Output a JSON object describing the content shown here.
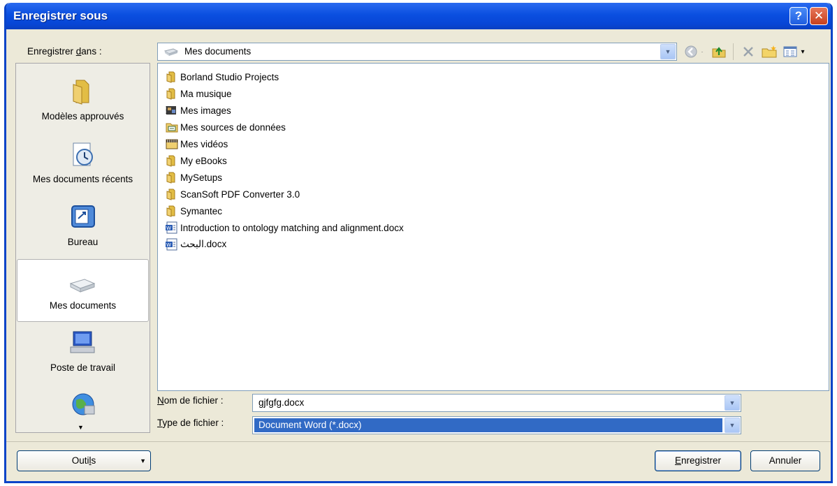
{
  "window": {
    "title": "Enregistrer sous",
    "help_label": "?",
    "close_label": "✕"
  },
  "save_in": {
    "label_pre": "Enregistrer ",
    "label_ul": "d",
    "label_post": "ans :",
    "value": "Mes documents"
  },
  "places": [
    {
      "label": "Modèles approuvés",
      "icon": "folder-icon"
    },
    {
      "label": "Mes documents récents",
      "icon": "recent-documents-icon"
    },
    {
      "label": "Bureau",
      "icon": "desktop-icon"
    },
    {
      "label": "Mes documents",
      "icon": "my-documents-icon",
      "selected": true
    },
    {
      "label": "Poste de travail",
      "icon": "my-computer-icon"
    }
  ],
  "files": [
    {
      "name": "Borland Studio Projects",
      "icon": "folder-icon"
    },
    {
      "name": "Ma musique",
      "icon": "music-folder-icon"
    },
    {
      "name": "Mes images",
      "icon": "pictures-folder-icon"
    },
    {
      "name": "Mes sources de données",
      "icon": "data-sources-folder-icon"
    },
    {
      "name": "Mes vidéos",
      "icon": "videos-folder-icon"
    },
    {
      "name": "My eBooks",
      "icon": "folder-icon"
    },
    {
      "name": "MySetups",
      "icon": "folder-icon"
    },
    {
      "name": "ScanSoft PDF Converter 3.0",
      "icon": "folder-icon"
    },
    {
      "name": "Symantec",
      "icon": "folder-icon"
    },
    {
      "name": "Introduction to ontology matching and alignment.docx",
      "icon": "word-document-icon"
    },
    {
      "name": "البحث.docx",
      "icon": "word-document-icon"
    }
  ],
  "filename": {
    "label_ul": "N",
    "label_post": "om de fichier :",
    "value": "gjfgfg.docx"
  },
  "filetype": {
    "label_ul": "T",
    "label_post": "ype de fichier :",
    "value": "Document Word (*.docx)"
  },
  "buttons": {
    "tools_pre": "Outi",
    "tools_ul": "l",
    "tools_post": "s",
    "save_ul": "E",
    "save_post": "nregistrer",
    "cancel": "Annuler"
  },
  "colors": {
    "title_blue": "#0a4fe0",
    "selection_blue": "#316ac5"
  }
}
